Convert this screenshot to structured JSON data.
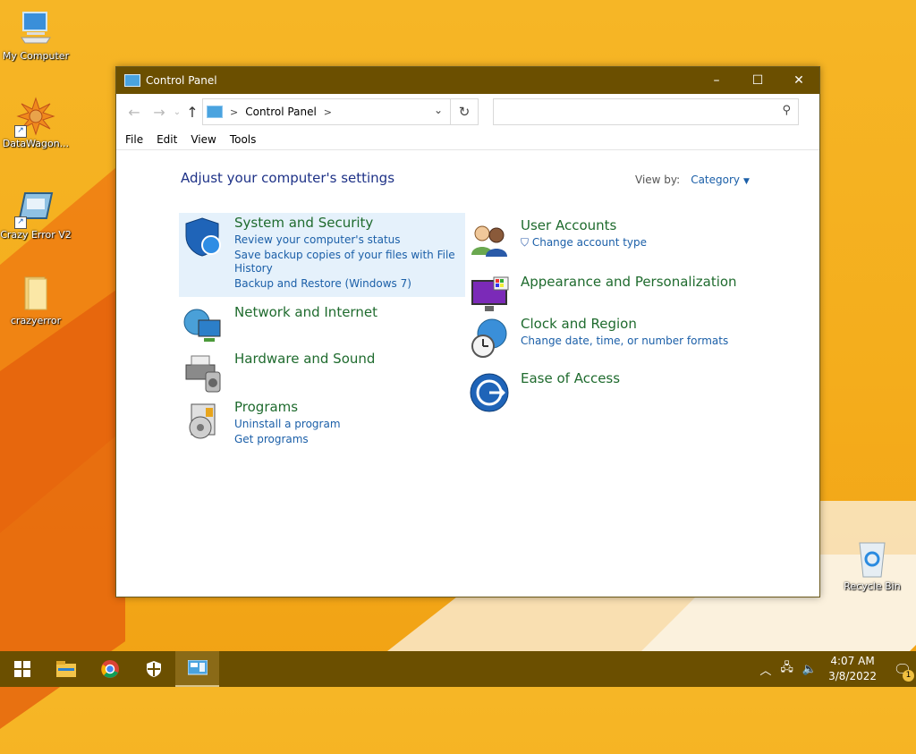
{
  "desktop": {
    "icons": [
      {
        "label": "My Computer",
        "icon": "computer-icon"
      },
      {
        "label": "DataWagon...",
        "icon": "datawagon-icon"
      },
      {
        "label": "Crazy Error V2",
        "icon": "crazy-error-icon"
      },
      {
        "label": "crazyerror",
        "icon": "folder-icon"
      },
      {
        "label": "Recycle Bin",
        "icon": "recycle-bin-icon"
      }
    ]
  },
  "window": {
    "title": "Control Panel",
    "address": {
      "path_item": "Control Panel",
      "separator": ">"
    },
    "search": {
      "placeholder": ""
    },
    "menu": [
      "File",
      "Edit",
      "View",
      "Tools"
    ],
    "heading": "Adjust your computer's settings",
    "view_by": {
      "label": "View by:",
      "value": "Category"
    },
    "categories": [
      {
        "title": "System and Security",
        "icon": "shield-icon",
        "links": [
          "Review your computer's status",
          "Save backup copies of your files with File History",
          "Backup and Restore (Windows 7)"
        ],
        "links_display": [
          "Review your computer's status",
          "Save backup copies of your files with File",
          "History",
          "Backup and Restore (Windows 7)"
        ]
      },
      {
        "title": "Network and Internet",
        "icon": "network-icon",
        "links": []
      },
      {
        "title": "Hardware and Sound",
        "icon": "printer-icon",
        "links": []
      },
      {
        "title": "Programs",
        "icon": "programs-icon",
        "links": [
          "Uninstall a program",
          "Get programs"
        ]
      },
      {
        "title": "User Accounts",
        "icon": "users-icon",
        "links": [
          "Change account type"
        ]
      },
      {
        "title": "Appearance and Personalization",
        "icon": "display-icon",
        "links": []
      },
      {
        "title": "Clock and Region",
        "icon": "clock-globe-icon",
        "links": [
          "Change date, time, or number formats"
        ]
      },
      {
        "title": "Ease of Access",
        "icon": "ease-of-access-icon",
        "links": []
      }
    ]
  },
  "taskbar": {
    "items": [
      "start-icon",
      "file-explorer-icon",
      "chrome-icon",
      "security-icon",
      "control-panel-icon"
    ],
    "clock": {
      "time": "4:07 AM",
      "date": "3/8/2022"
    },
    "notification_count": "1"
  },
  "colors": {
    "titlebar": "#6b4f00",
    "heading": "#1e3287",
    "category_title": "#1f6b2e",
    "link": "#1b5fa8"
  }
}
